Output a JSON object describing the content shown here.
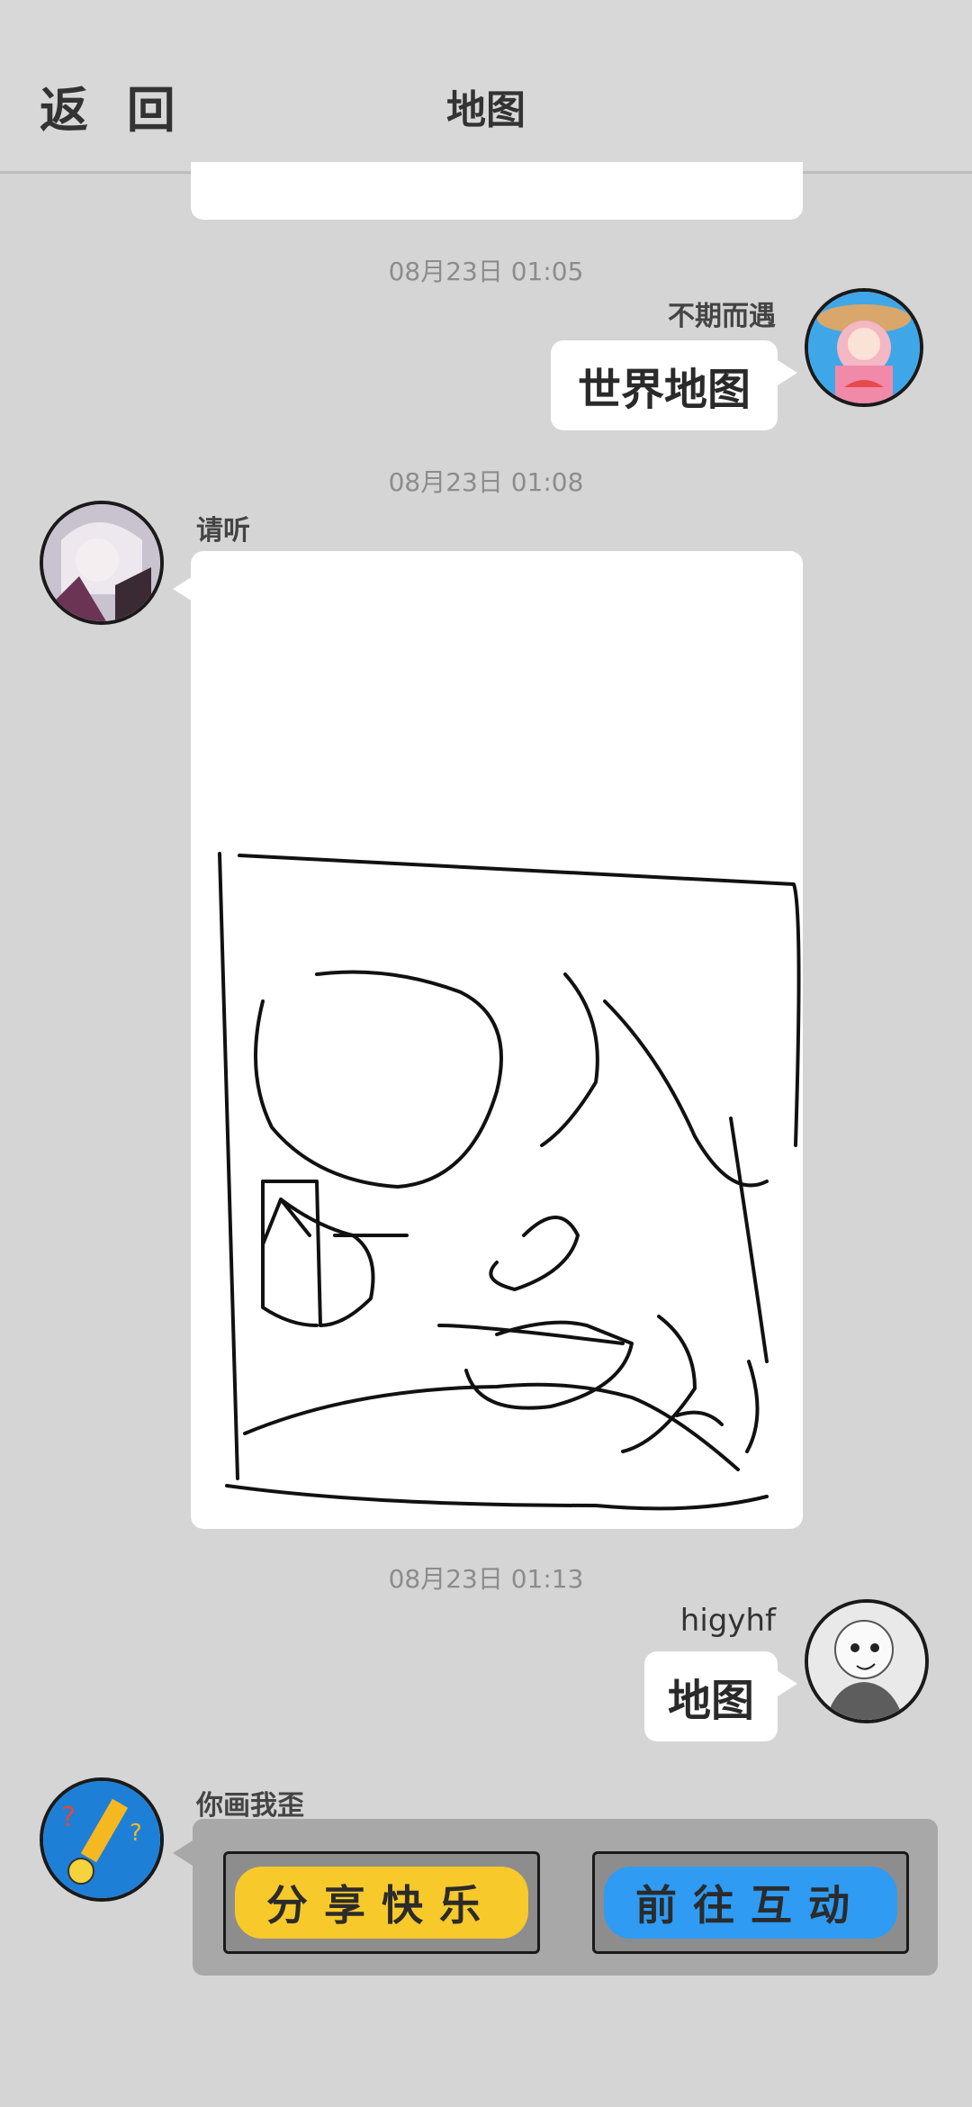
{
  "header": {
    "back_label": "返 回",
    "title": "地图"
  },
  "messages": [
    {
      "time": "08月23日  01:05",
      "sender": "不期而遇",
      "text": "世界地图"
    },
    {
      "time": "08月23日  01:08",
      "sender": "请听"
    },
    {
      "time": "08月23日  01:13",
      "sender": "higyhf",
      "text": "地图"
    },
    {
      "sender": "你画我歪",
      "buttons": [
        "分享快乐",
        "前往互动"
      ]
    }
  ],
  "colors": {
    "background": "#d5d5d5",
    "share_button": "#f7c92b",
    "interact_button": "#2f9bf3"
  }
}
